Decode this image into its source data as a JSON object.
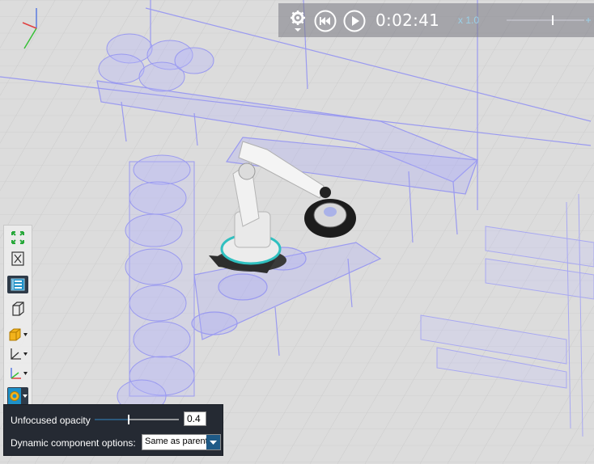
{
  "playback": {
    "time": "0:02:41",
    "speed_label": "x 1.0"
  },
  "toolbar": {
    "items": [
      {
        "icon": "fit-to-view-icon"
      },
      {
        "icon": "fit-selection-icon"
      },
      {
        "icon": "layout-toggle-icon"
      },
      {
        "icon": "perspective-cube-icon"
      },
      {
        "icon": "render-mode-icon"
      },
      {
        "icon": "axis-frame-icon"
      },
      {
        "icon": "world-axis-icon"
      },
      {
        "icon": "opacity-settings-icon"
      }
    ]
  },
  "panel": {
    "opacity_label": "Unfocused opacity",
    "opacity_value": "0.4",
    "dynamic_label": "Dynamic component options:",
    "dynamic_value": "Same as parent"
  },
  "colors": {
    "wireframe": "#8c8cf0",
    "robot_body": "#f2f2f2",
    "highlight": "#30c0c0",
    "panel_bg": "#252a33",
    "accent": "#1f5a86"
  }
}
